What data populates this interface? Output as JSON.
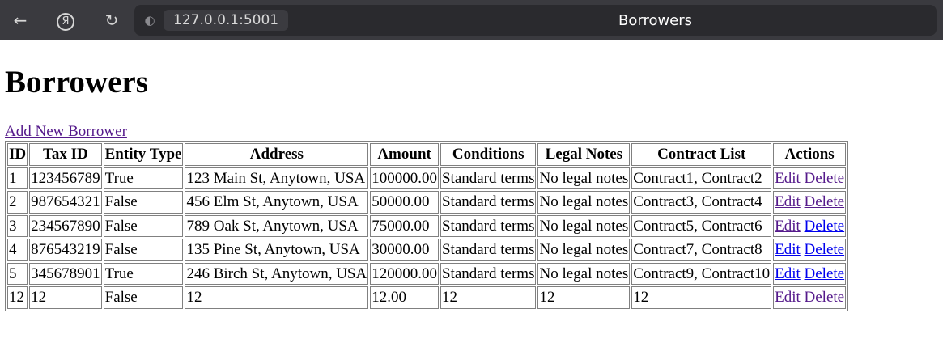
{
  "browser": {
    "url": "127.0.0.1:5001",
    "tab_title": "Borrowers"
  },
  "page": {
    "heading": "Borrowers",
    "add_link": "Add New Borrower"
  },
  "table": {
    "headers": [
      "ID",
      "Tax ID",
      "Entity Type",
      "Address",
      "Amount",
      "Conditions",
      "Legal Notes",
      "Contract List",
      "Actions"
    ],
    "rows": [
      {
        "id": "1",
        "tax_id": "123456789",
        "entity_type": "True",
        "address": "123 Main St, Anytown, USA",
        "amount": "100000.00",
        "conditions": "Standard terms",
        "legal_notes": "No legal notes",
        "contracts": "Contract1, Contract2",
        "edit": "Edit",
        "delete": "Delete"
      },
      {
        "id": "2",
        "tax_id": "987654321",
        "entity_type": "False",
        "address": "456 Elm St, Anytown, USA",
        "amount": "50000.00",
        "conditions": "Standard terms",
        "legal_notes": "No legal notes",
        "contracts": "Contract3, Contract4",
        "edit": "Edit",
        "delete": "Delete"
      },
      {
        "id": "3",
        "tax_id": "234567890",
        "entity_type": "False",
        "address": "789 Oak St, Anytown, USA",
        "amount": "75000.00",
        "conditions": "Standard terms",
        "legal_notes": "No legal notes",
        "contracts": "Contract5, Contract6",
        "edit": "Edit",
        "delete": "Delete"
      },
      {
        "id": "4",
        "tax_id": "876543219",
        "entity_type": "False",
        "address": "135 Pine St, Anytown, USA",
        "amount": "30000.00",
        "conditions": "Standard terms",
        "legal_notes": "No legal notes",
        "contracts": "Contract7, Contract8",
        "edit": "Edit",
        "delete": "Delete"
      },
      {
        "id": "5",
        "tax_id": "345678901",
        "entity_type": "True",
        "address": "246 Birch St, Anytown, USA",
        "amount": "120000.00",
        "conditions": "Standard terms",
        "legal_notes": "No legal notes",
        "contracts": "Contract9, Contract10",
        "edit": "Edit",
        "delete": "Delete"
      },
      {
        "id": "12",
        "tax_id": "12",
        "entity_type": "False",
        "address": "12",
        "amount": "12.00",
        "conditions": "12",
        "legal_notes": "12",
        "contracts": "12",
        "edit": "Edit",
        "delete": "Delete"
      }
    ]
  },
  "icons": {
    "back": "back-arrow-icon",
    "browser": "yandex-browser-icon",
    "reload": "reload-icon",
    "site": "globe-icon"
  },
  "colors": {
    "link_visited": "#551a8b",
    "link_unvisited": "#0000ee",
    "toolbar_bg": "#3a3a3f"
  }
}
